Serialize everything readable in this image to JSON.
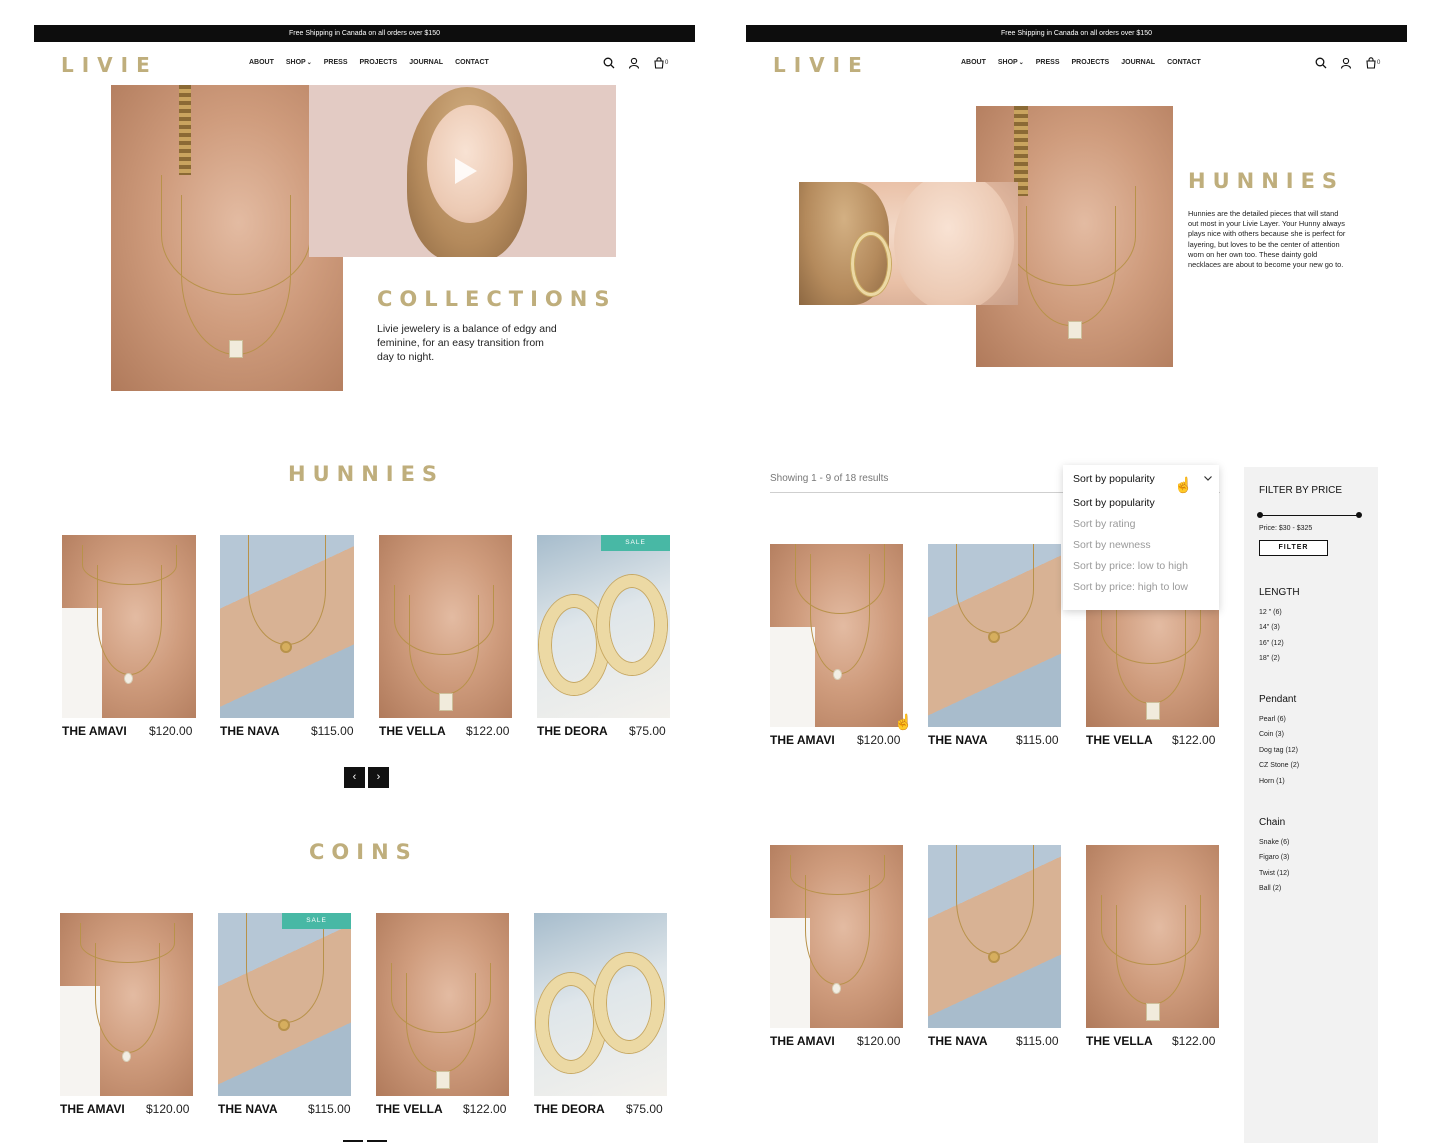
{
  "shared": {
    "announcement": "Free Shipping in Canada on all orders over $150",
    "logo": "LIVIE",
    "nav": [
      "ABOUT",
      "SHOP",
      "PRESS",
      "PROJECTS",
      "JOURNAL",
      "CONTACT"
    ],
    "cart_count": "0",
    "icons": [
      "search-icon",
      "user-icon",
      "cart-icon",
      "chevron-down-icon"
    ]
  },
  "left": {
    "hero": {
      "title": "COLLECTIONS",
      "text_lines": [
        "Livie jewelery is a balance of edgy and",
        "feminine, for an easy transition from",
        "day to night."
      ]
    },
    "hunnies": {
      "title": "HUNNIES",
      "products": [
        {
          "name": "THE AMAVI",
          "price": "$120.00",
          "sale": ""
        },
        {
          "name": "THE NAVA",
          "price": "$115.00",
          "sale": ""
        },
        {
          "name": "THE VELLA",
          "price": "$122.00",
          "sale": ""
        },
        {
          "name": "THE DEORA",
          "price": "$75.00",
          "sale": "SALE"
        }
      ],
      "prev": "‹",
      "next": "›"
    },
    "coins": {
      "title": "COINS",
      "products": [
        {
          "name": "THE AMAVI",
          "price": "$120.00",
          "sale": ""
        },
        {
          "name": "THE NAVA",
          "price": "$115.00",
          "sale": "SALE"
        },
        {
          "name": "THE VELLA",
          "price": "$122.00",
          "sale": ""
        },
        {
          "name": "THE DEORA",
          "price": "$75.00",
          "sale": ""
        }
      ]
    }
  },
  "right": {
    "hero": {
      "title": "HUNNIES",
      "text_lines": [
        "Hunnies are the detailed pieces that will stand",
        "out most in your Livie Layer. Your Hunny always",
        "plays nice with others because she is perfect for",
        "layering, but loves to be the center of attention",
        "worn on her own too. These dainty gold",
        "necklaces are about to become your new go to."
      ]
    },
    "results": "Showing 1 - 9 of 18 results",
    "sort": {
      "selected": "Sort by popularity",
      "options": [
        "Sort by popularity",
        "Sort by rating",
        "Sort by newness",
        "Sort by price: low to high",
        "Sort by price: high to low"
      ]
    },
    "sidebar": {
      "filter_title": "FILTER BY PRICE",
      "price_range": "Price: $30 - $325",
      "filter_button": "FILTER",
      "length_title": "LENGTH",
      "length": [
        "12 \" (6)",
        "14\" (3)",
        "16\" (12)",
        "18\" (2)"
      ],
      "pendant_title": "Pendant",
      "pendant": [
        "Pearl (6)",
        "Coin (3)",
        "Dog tag (12)",
        "CZ Stone (2)",
        "Horn (1)"
      ],
      "chain_title": "Chain",
      "chain": [
        "Snake (6)",
        "Figaro (3)",
        "Twist (12)",
        "Ball (2)"
      ]
    },
    "grid": [
      {
        "name": "THE AMAVI",
        "price": "$120.00"
      },
      {
        "name": "THE NAVA",
        "price": "$115.00"
      },
      {
        "name": "THE VELLA",
        "price": "$122.00"
      },
      {
        "name": "THE AMAVI",
        "price": "$120.00"
      },
      {
        "name": "THE NAVA",
        "price": "$115.00"
      },
      {
        "name": "THE VELLA",
        "price": "$122.00"
      }
    ]
  },
  "colors": {
    "gold": "#bfae7c",
    "sale": "#48b8a5",
    "dark": "#0d0d0d",
    "sidebar": "#f2f2f2"
  }
}
